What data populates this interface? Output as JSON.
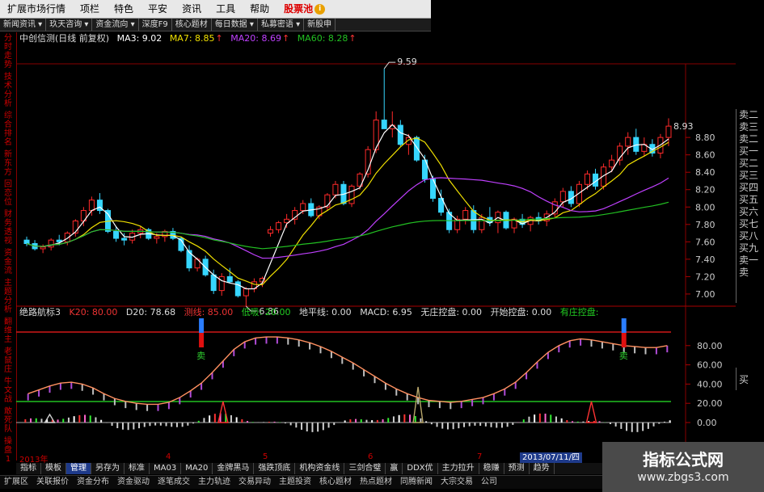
{
  "menu": [
    "扩展市场行情",
    "项栏",
    "特色",
    "平安",
    "资讯",
    "工具",
    "帮助"
  ],
  "menu_pool": "股票池",
  "menu_pool_badge": "i",
  "toolbar": [
    "新闻资讯 ▾",
    "玖天咨询 ▾",
    "资金流向 ▾",
    "深度F9",
    "核心题材",
    "每日数据 ▾",
    "私募密语 ▾",
    "新股申"
  ],
  "sidebar": [
    "分时走势",
    "技术分析",
    "综合排名",
    "新东方",
    "回恋位",
    "财务透视",
    "资金流",
    "主题分析",
    "翻维主",
    "老鼠庄",
    "牛文战",
    "敢死队",
    "操盘1"
  ],
  "ma": {
    "name": "中创信测(日线 前复权)",
    "ma3_label": "MA3: 9.02",
    "ma7_label": "MA7: 8.85",
    "ma20_label": "MA20: 8.69",
    "ma60_label": "MA60: 8.28",
    "colors": {
      "ma3": "#ffffff",
      "ma7": "#f0e000",
      "ma20": "#c040ff",
      "ma60": "#22c022"
    }
  },
  "indicator": {
    "name": "绝路航标3",
    "k20_label": "K20: 80.00",
    "d20_label": "D20: 78.68",
    "cx_label": "测线: 85.00",
    "dx_label": "低吸: 20.00",
    "dpx_label": "地平线: 0.00",
    "macd_label": "MACD: 6.95",
    "wzk_label": "无庄控盘: 0.00",
    "kskp_label": "开始控盘: 0.00",
    "yzkp_label": "有庄控盘:"
  },
  "right_panel": [
    "卖二",
    "卖三",
    "卖二",
    "买一",
    "买二",
    "买三",
    "买四",
    "买五",
    "买六",
    "买七",
    "买八",
    "买九",
    "卖一",
    "卖"
  ],
  "right_panel2": "买",
  "price_labels": [
    "8.80",
    "8.60",
    "8.40",
    "8.20",
    "8.00",
    "7.80",
    "7.60",
    "7.40",
    "7.20",
    "7.00"
  ],
  "indicator_labels": [
    "80.00",
    "60.00",
    "40.00",
    "20.00",
    "0.00"
  ],
  "annotations": {
    "high": "9.59",
    "low": "6.86",
    "current": "8.93",
    "sell": "卖"
  },
  "dates": {
    "year": "2013年",
    "m4": "4",
    "m5": "5",
    "m6": "6",
    "m7": "7",
    "selected": "2013/07/11/四"
  },
  "bottom_tabs": [
    "指标",
    "模板",
    "管理",
    "另存为",
    "标准",
    "MA03",
    "MA20",
    "金牌黑马",
    "强跌顶底",
    "机构资金线",
    "三剑合璧",
    "赢",
    "DDX优",
    "主力拉升",
    "稳赚",
    "预测",
    "趋势"
  ],
  "bottom_tab_active": 2,
  "quick_links": [
    "扩展区",
    "关联报价",
    "资金分布",
    "资金驱动",
    "逐笔成交",
    "主力轨迹",
    "交易异动",
    "主题投资",
    "核心题材",
    "热点题材",
    "同腾新闻",
    "大宗交易",
    "公司"
  ],
  "watermark": {
    "title": "指标公式网",
    "url": "www.zbgs3.com"
  },
  "chart_data": [
    {
      "type": "candlestick",
      "title": "中创信测(日线 前复权)",
      "ylim": [
        6.86,
        9.6
      ],
      "y_ticks": [
        7.0,
        7.2,
        7.4,
        7.6,
        7.8,
        8.0,
        8.2,
        8.4,
        8.6,
        8.8
      ],
      "high_annotation": 9.59,
      "low_annotation": 6.86,
      "last_annotation": 8.93,
      "candles_ohlc": [
        [
          7.62,
          7.66,
          7.55,
          7.58
        ],
        [
          7.58,
          7.62,
          7.5,
          7.52
        ],
        [
          7.52,
          7.57,
          7.47,
          7.54
        ],
        [
          7.54,
          7.64,
          7.5,
          7.62
        ],
        [
          7.62,
          7.68,
          7.56,
          7.6
        ],
        [
          7.6,
          7.72,
          7.56,
          7.7
        ],
        [
          7.7,
          7.86,
          7.66,
          7.84
        ],
        [
          7.84,
          8.0,
          7.78,
          7.96
        ],
        [
          7.96,
          8.12,
          7.9,
          8.08
        ],
        [
          8.08,
          8.16,
          7.92,
          7.96
        ],
        [
          7.96,
          7.98,
          7.7,
          7.72
        ],
        [
          7.72,
          7.78,
          7.6,
          7.64
        ],
        [
          7.64,
          7.7,
          7.56,
          7.62
        ],
        [
          7.62,
          7.74,
          7.58,
          7.7
        ],
        [
          7.7,
          7.78,
          7.64,
          7.74
        ],
        [
          7.74,
          7.76,
          7.62,
          7.64
        ],
        [
          7.64,
          7.7,
          7.58,
          7.66
        ],
        [
          7.66,
          7.74,
          7.6,
          7.72
        ],
        [
          7.72,
          7.76,
          7.62,
          7.64
        ],
        [
          7.64,
          7.66,
          7.48,
          7.5
        ],
        [
          7.5,
          7.56,
          7.26,
          7.3
        ],
        [
          7.3,
          7.42,
          7.26,
          7.4
        ],
        [
          7.4,
          7.44,
          7.2,
          7.22
        ],
        [
          7.22,
          7.28,
          7.0,
          7.04
        ],
        [
          7.04,
          7.24,
          6.98,
          7.2
        ],
        [
          7.2,
          7.3,
          7.12,
          7.14
        ],
        [
          7.14,
          7.16,
          6.96,
          6.98
        ],
        [
          6.98,
          7.08,
          6.86,
          7.06
        ],
        [
          7.06,
          7.18,
          7.02,
          7.14
        ],
        [
          7.14,
          7.2,
          7.08,
          7.18
        ],
        [
          7.7,
          7.78,
          7.66,
          7.74
        ],
        [
          7.74,
          7.84,
          7.7,
          7.82
        ],
        [
          7.82,
          7.92,
          7.76,
          7.86
        ],
        [
          7.86,
          8.0,
          7.8,
          7.96
        ],
        [
          7.96,
          8.08,
          7.92,
          8.04
        ],
        [
          8.04,
          8.1,
          7.88,
          7.9
        ],
        [
          7.9,
          8.02,
          7.86,
          8.0
        ],
        [
          8.0,
          8.16,
          7.96,
          8.14
        ],
        [
          8.14,
          8.3,
          8.1,
          8.26
        ],
        [
          8.26,
          8.3,
          8.02,
          8.04
        ],
        [
          8.04,
          8.26,
          8.0,
          8.24
        ],
        [
          8.24,
          8.4,
          8.2,
          8.38
        ],
        [
          8.38,
          8.7,
          8.34,
          8.66
        ],
        [
          8.66,
          9.1,
          8.62,
          9.0
        ],
        [
          9.0,
          9.59,
          8.96,
          8.9
        ],
        [
          8.9,
          9.1,
          8.8,
          8.94
        ],
        [
          8.94,
          9.0,
          8.7,
          8.72
        ],
        [
          8.72,
          8.84,
          8.6,
          8.8
        ],
        [
          8.8,
          8.82,
          8.52,
          8.54
        ],
        [
          8.54,
          8.6,
          8.28,
          8.32
        ],
        [
          8.32,
          8.36,
          8.06,
          8.1
        ],
        [
          8.1,
          8.2,
          7.9,
          7.94
        ],
        [
          7.94,
          7.98,
          7.7,
          7.74
        ],
        [
          7.74,
          7.9,
          7.7,
          7.86
        ],
        [
          7.86,
          8.0,
          7.8,
          7.96
        ],
        [
          7.96,
          8.02,
          7.7,
          7.74
        ],
        [
          7.74,
          7.92,
          7.7,
          7.88
        ],
        [
          7.88,
          8.0,
          7.78,
          7.82
        ],
        [
          7.82,
          7.96,
          7.7,
          7.94
        ],
        [
          7.94,
          7.96,
          7.74,
          7.76
        ],
        [
          7.76,
          7.88,
          7.7,
          7.86
        ],
        [
          7.86,
          7.92,
          7.76,
          7.8
        ],
        [
          7.8,
          7.9,
          7.72,
          7.88
        ],
        [
          7.88,
          7.94,
          7.8,
          7.84
        ],
        [
          7.84,
          7.96,
          7.78,
          7.92
        ],
        [
          7.92,
          8.1,
          7.88,
          8.06
        ],
        [
          8.06,
          8.22,
          8.0,
          8.18
        ],
        [
          8.18,
          8.24,
          8.0,
          8.04
        ],
        [
          8.04,
          8.3,
          8.0,
          8.26
        ],
        [
          8.26,
          8.42,
          8.2,
          8.38
        ],
        [
          8.38,
          8.44,
          8.2,
          8.24
        ],
        [
          8.24,
          8.5,
          8.2,
          8.46
        ],
        [
          8.46,
          8.6,
          8.4,
          8.54
        ],
        [
          8.54,
          8.74,
          8.48,
          8.7
        ],
        [
          8.7,
          8.86,
          8.6,
          8.8
        ],
        [
          8.8,
          8.9,
          8.6,
          8.64
        ],
        [
          8.64,
          8.8,
          8.58,
          8.72
        ],
        [
          8.72,
          8.78,
          8.58,
          8.62
        ],
        [
          8.62,
          8.84,
          8.56,
          8.8
        ],
        [
          8.8,
          9.02,
          8.7,
          8.93
        ]
      ]
    },
    {
      "type": "line",
      "title": "绝路航标3",
      "ylim": [
        0,
        100
      ],
      "y_ticks": [
        0,
        20,
        40,
        60,
        80
      ],
      "series": [
        {
          "name": "K20",
          "values": [
            30,
            34,
            38,
            41,
            42,
            40,
            36,
            30,
            25,
            22,
            20,
            19,
            19,
            21,
            26,
            33,
            41,
            52,
            64,
            76,
            84,
            88,
            89,
            89,
            88,
            86,
            83,
            79,
            74,
            68,
            62,
            55,
            48,
            41,
            35,
            30,
            26,
            23,
            22,
            21,
            22,
            24,
            26,
            30,
            35,
            42,
            52,
            63,
            73,
            80,
            85,
            87,
            86,
            84,
            82,
            80,
            79,
            78,
            78,
            80
          ]
        }
      ]
    }
  ]
}
